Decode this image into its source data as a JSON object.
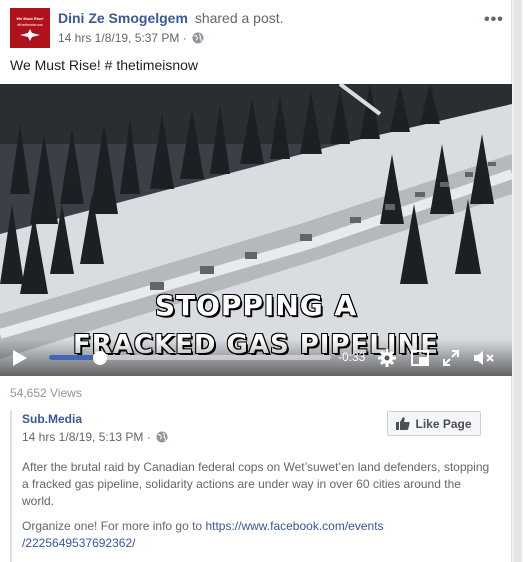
{
  "post": {
    "author": "Dini Ze Smogelgem",
    "action": "shared a post.",
    "meta": "14 hrs 1/8/19, 5:37 PM ·",
    "text": "We Must Rise! # thetimeisnow",
    "avatar_text_1": "We Must Rise!",
    "avatar_text_2": "#thetimeisnow"
  },
  "video": {
    "caption_line_1": "STOPPING A",
    "caption_line_2": "FRACKED GAS PIPELINE",
    "time": "-0:33",
    "progress": 0.18,
    "views": "54,652 Views"
  },
  "shared": {
    "page_name": "Sub.Media",
    "meta": "14 hrs 1/8/19, 5:13 PM ·",
    "like_label": "Like Page",
    "description": "After the brutal raid by Canadian federal cops on Wet’suwet’en land defenders, stopping a fracked gas pipeline, solidarity actions are under way in over 60 cities around the world.",
    "organize_text": "Organize one! For more info go to ",
    "link_line_1": "https://www.facebook.com/events",
    "link_line_2": "/2225649537692362/"
  },
  "colors": {
    "link": "#385898",
    "accent": "#4267b2",
    "avatar_bg": "#b0121b"
  }
}
